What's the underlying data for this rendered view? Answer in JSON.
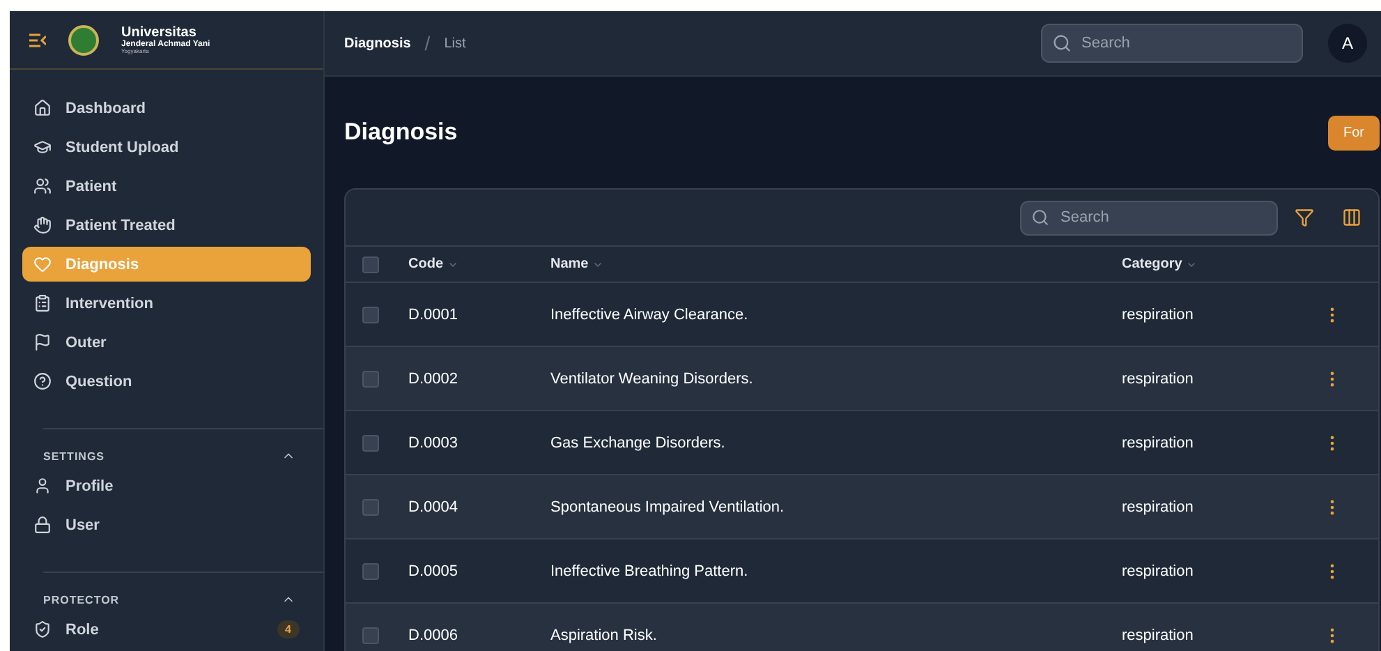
{
  "brand": {
    "name": "Universitas",
    "line2": "Jenderal Achmad Yani",
    "line3": "Yogyakarta"
  },
  "nav": [
    {
      "label": "Dashboard",
      "selected": false
    },
    {
      "label": "Student Upload",
      "selected": false
    },
    {
      "label": "Patient",
      "selected": false
    },
    {
      "label": "Patient Treated",
      "selected": false
    },
    {
      "label": "Diagnosis",
      "selected": true
    },
    {
      "label": "Intervention",
      "selected": false
    },
    {
      "label": "Outer",
      "selected": false
    },
    {
      "label": "Question",
      "selected": false
    }
  ],
  "groups": [
    {
      "title": "SETTINGS",
      "expanded": true,
      "items": [
        {
          "label": "Profile",
          "selected": false
        },
        {
          "label": "User",
          "selected": false
        }
      ]
    },
    {
      "title": "PROTECTOR",
      "expanded": true,
      "items": [
        {
          "label": "Role",
          "selected": false,
          "badge": "4"
        }
      ]
    }
  ],
  "breadcrumbs": [
    "Diagnosis",
    "List"
  ],
  "breadcrumb_separator": "/",
  "top_search": {
    "placeholder": "Search"
  },
  "avatar": "A",
  "page_title": "Diagnosis",
  "action_button": "For",
  "table": {
    "search": {
      "placeholder": "Search"
    },
    "select_all": {
      "checked": false
    },
    "columns": [
      "Code",
      "Name",
      "Category"
    ],
    "rows": [
      {
        "code": "D.0001",
        "name": "Ineffective Airway Clearance.",
        "category": "respiration",
        "checked": false
      },
      {
        "code": "D.0002",
        "name": "Ventilator Weaning Disorders.",
        "category": "respiration",
        "checked": false
      },
      {
        "code": "D.0003",
        "name": "Gas Exchange Disorders.",
        "category": "respiration",
        "checked": false
      },
      {
        "code": "D.0004",
        "name": "Spontaneous Impaired Ventilation.",
        "category": "respiration",
        "checked": false
      },
      {
        "code": "D.0005",
        "name": "Ineffective Breathing Pattern.",
        "category": "respiration",
        "checked": false
      },
      {
        "code": "D.0006",
        "name": "Aspiration Risk.",
        "category": "respiration",
        "checked": false
      }
    ]
  }
}
